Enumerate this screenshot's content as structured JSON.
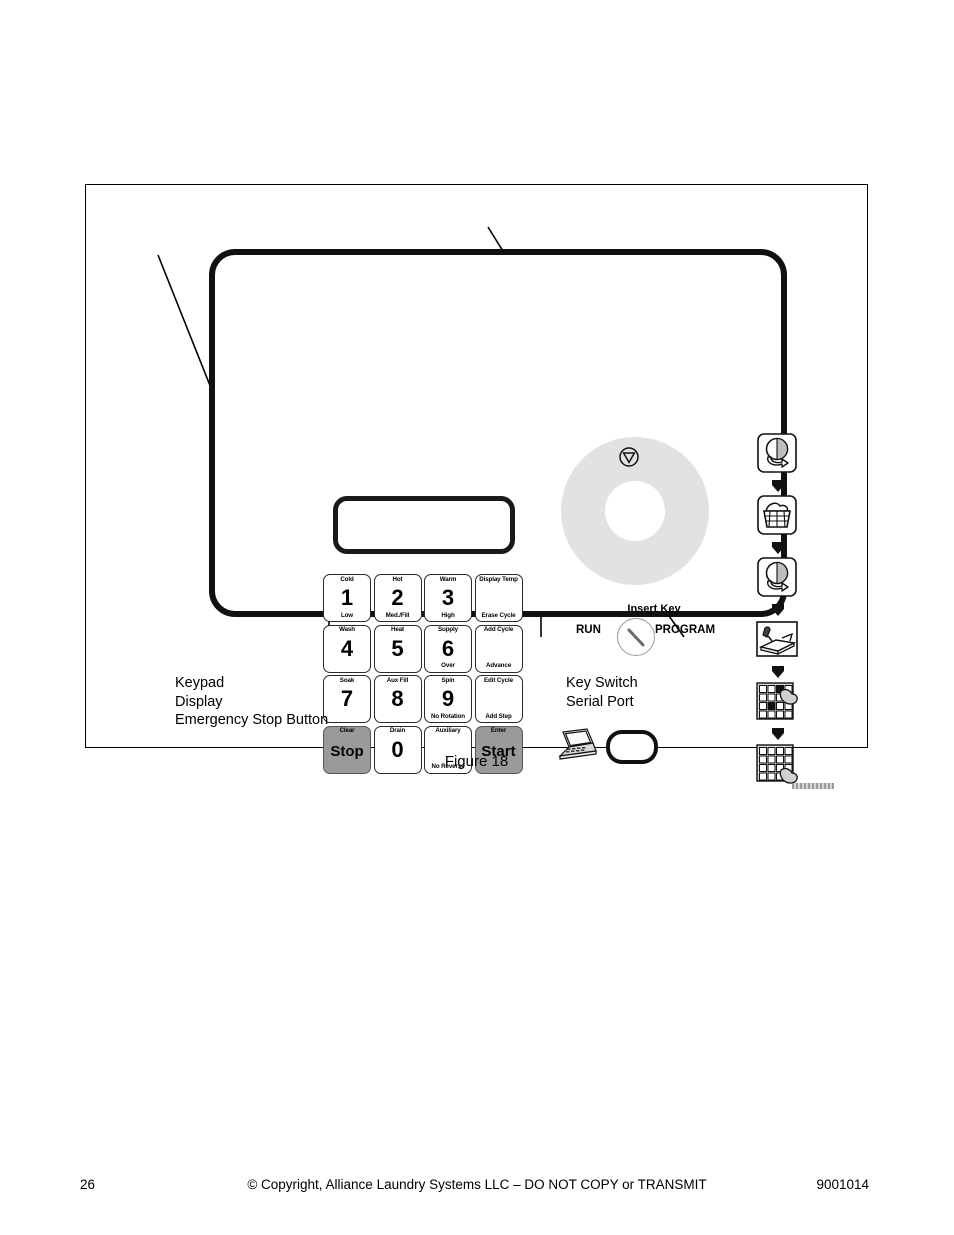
{
  "figure": {
    "caption": "Figure 18",
    "panel_part_number": "",
    "display": {
      "name": "display-window",
      "value": ""
    },
    "emergency_stop": {
      "symbol": "circled-triangle-stop-symbol"
    },
    "key_switch": {
      "label": "Insert Key",
      "left_position": "RUN",
      "right_position": "PROGRAM"
    },
    "serial_port": {
      "laptop_icon": "laptop-icon",
      "connector": "serial-port-connector"
    },
    "keypad": {
      "keys": [
        {
          "top": "Cold",
          "main": "1",
          "bottom": "Low",
          "shaded": false
        },
        {
          "top": "Hot",
          "main": "2",
          "bottom": "Med./Fill",
          "shaded": false
        },
        {
          "top": "Warm",
          "main": "3",
          "bottom": "High",
          "shaded": false
        },
        {
          "top": "Display Temp",
          "main": "",
          "bottom": "Erase Cycle",
          "shaded": false
        },
        {
          "top": "Wash",
          "main": "4",
          "bottom": "",
          "shaded": false
        },
        {
          "top": "Heat",
          "main": "5",
          "bottom": "",
          "shaded": false
        },
        {
          "top": "Supply",
          "main": "6",
          "bottom": "Over",
          "shaded": false
        },
        {
          "top": "Add Cycle",
          "main": "",
          "bottom": "Advance",
          "shaded": false
        },
        {
          "top": "Soak",
          "main": "7",
          "bottom": "",
          "shaded": false
        },
        {
          "top": "Aux Fill",
          "main": "8",
          "bottom": "",
          "shaded": false
        },
        {
          "top": "Spin",
          "main": "9",
          "bottom": "No Rotation",
          "shaded": false
        },
        {
          "top": "Edit Cycle",
          "main": "",
          "bottom": "Add Step",
          "shaded": false
        },
        {
          "top": "Clear",
          "main": "Stop",
          "bottom": "",
          "shaded": true
        },
        {
          "top": "Drain",
          "main": "0",
          "bottom": "",
          "shaded": false
        },
        {
          "top": "Auxiliary",
          "main": "",
          "bottom": "No Reverse",
          "shaded": false
        },
        {
          "top": "Enter",
          "main": "Start",
          "bottom": "",
          "shaded": true
        }
      ]
    },
    "instruction_icons": [
      {
        "name": "load-drum-icon"
      },
      {
        "name": "laundry-basket-icon"
      },
      {
        "name": "unload-drum-icon"
      },
      {
        "name": "fold-linen-icon"
      },
      {
        "name": "select-program-keypad-icon"
      },
      {
        "name": "press-start-keypad-icon"
      }
    ],
    "callouts": {
      "left": [
        "Keypad",
        "Display",
        "Emergency Stop Button"
      ],
      "right": [
        "Key Switch",
        "Serial Port"
      ]
    }
  },
  "footer": {
    "page_number": "26",
    "copyright": "© Copyright, Alliance Laundry Systems LLC – DO NOT COPY or TRANSMIT",
    "document_number": "9001014"
  }
}
